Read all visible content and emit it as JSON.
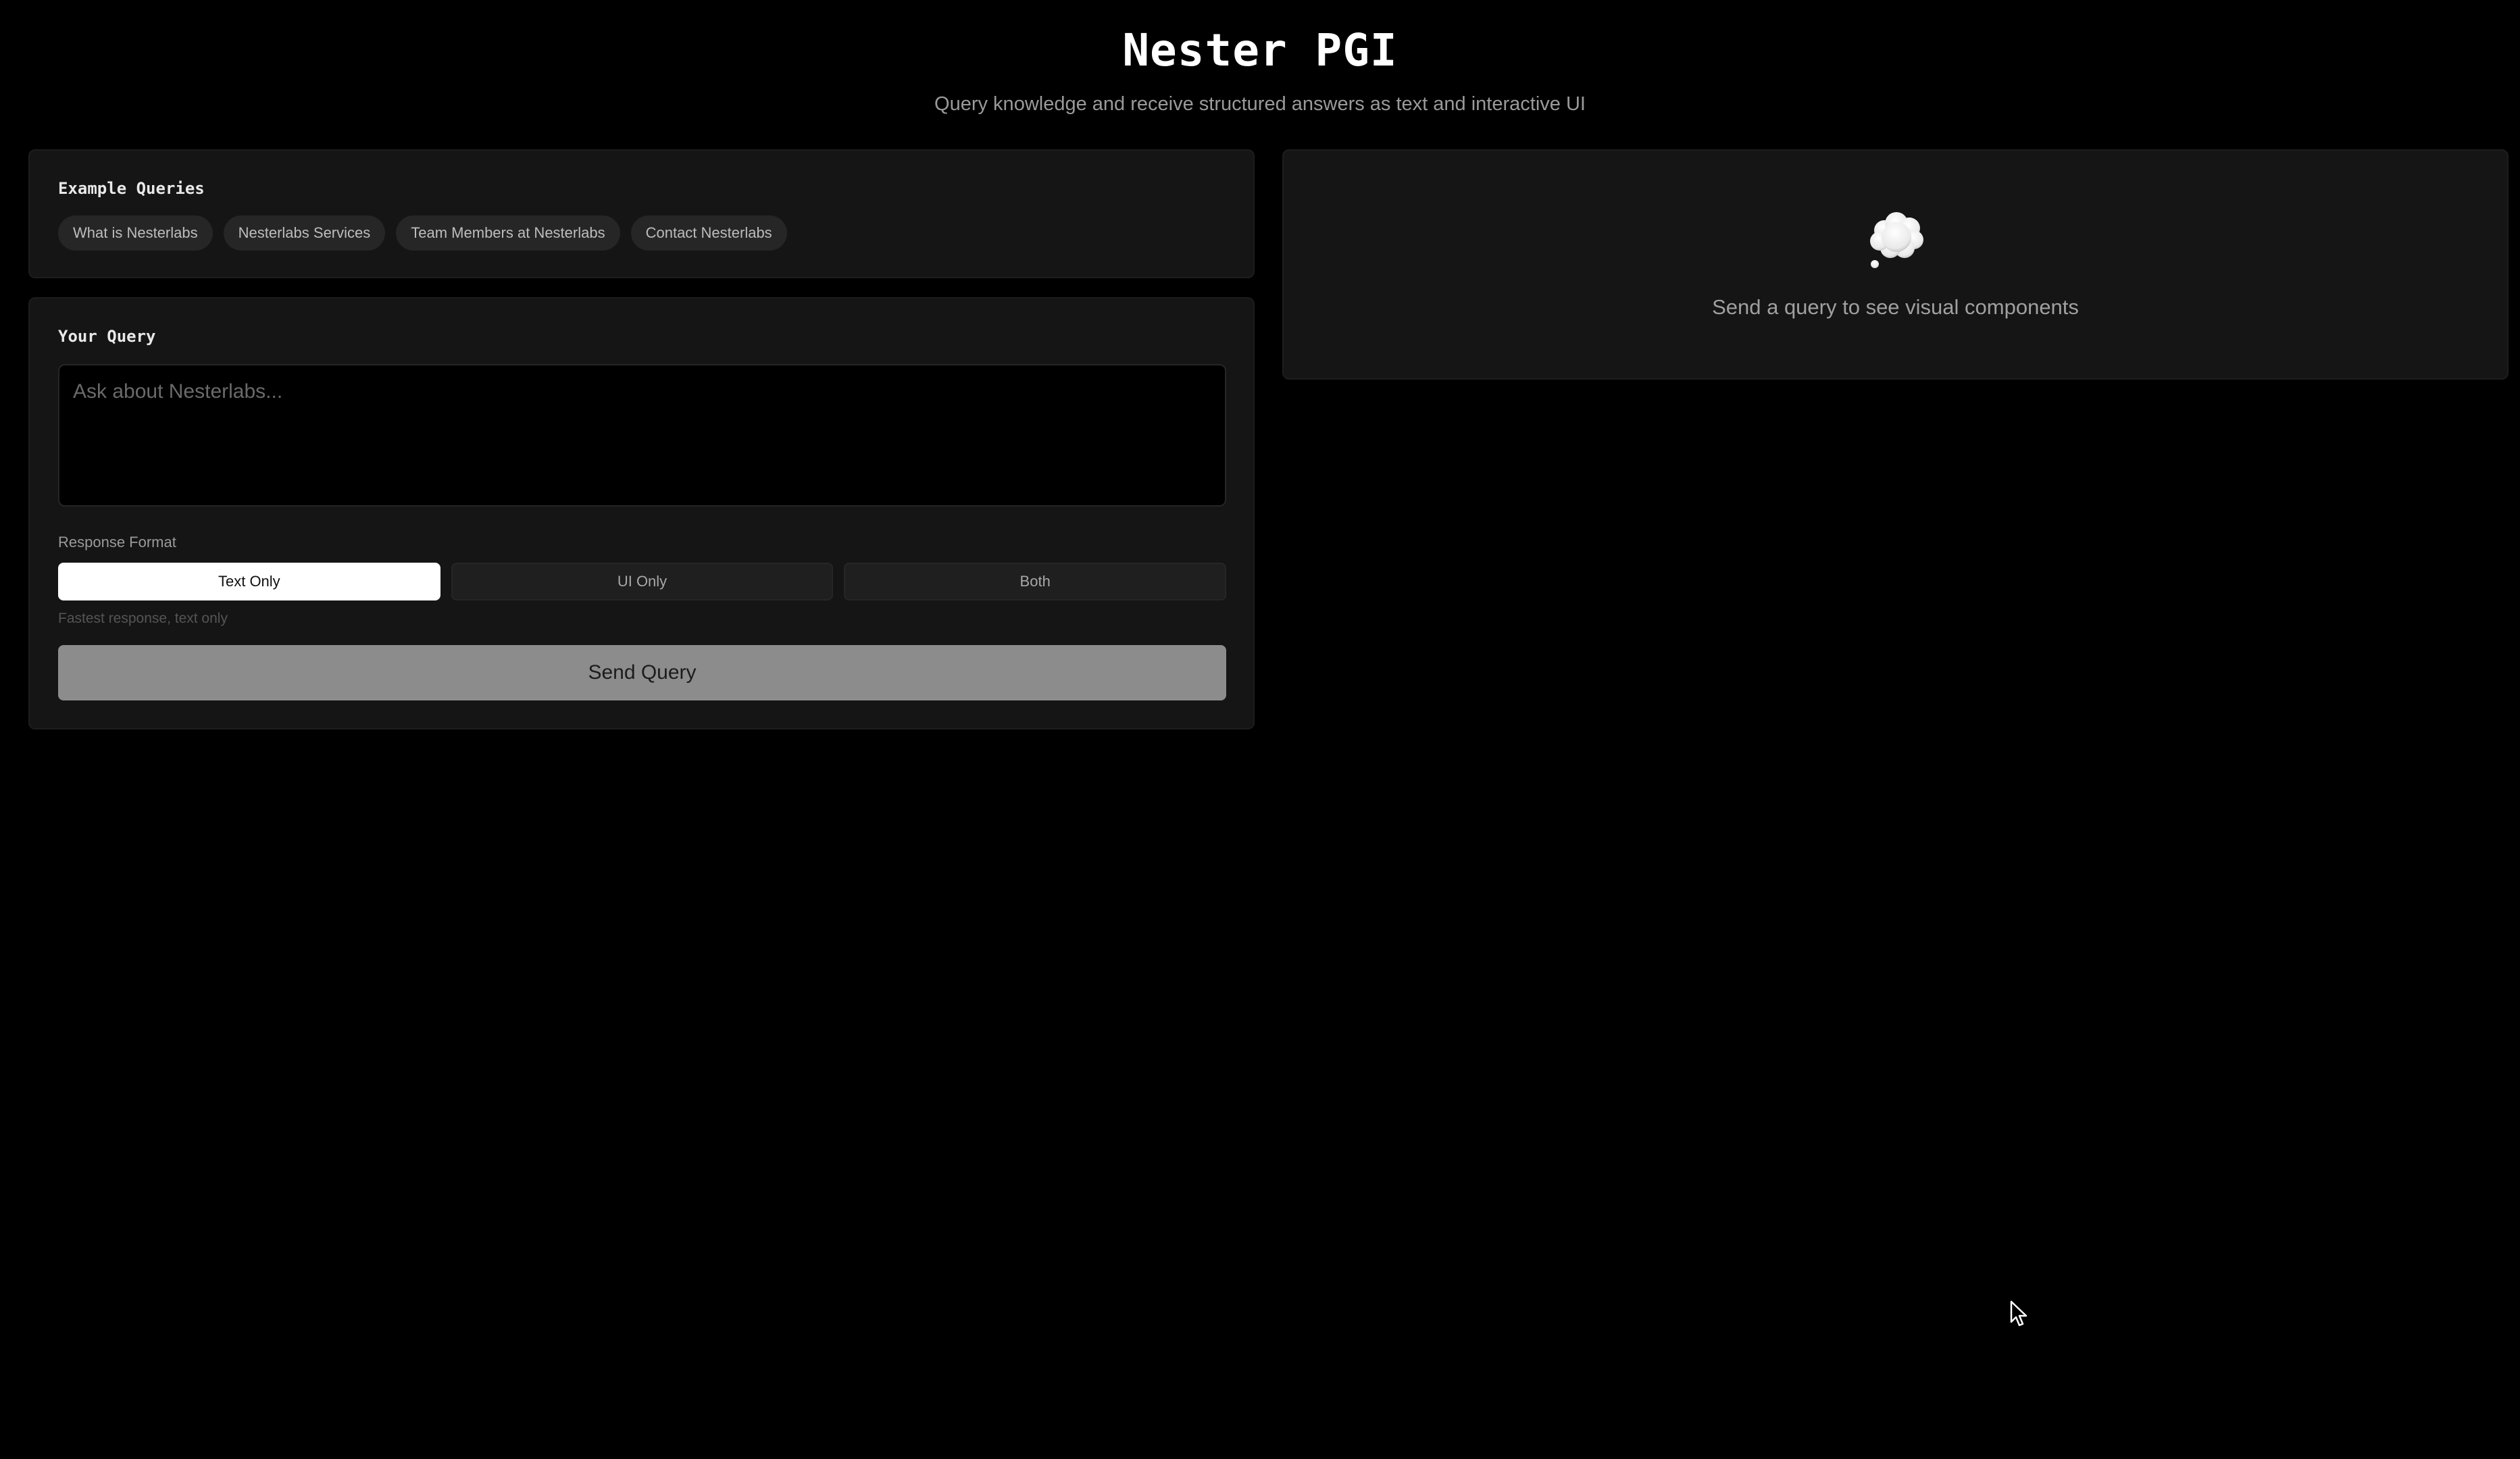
{
  "header": {
    "title": "Nester PGI",
    "subtitle": "Query knowledge and receive structured answers as text and interactive UI"
  },
  "examples": {
    "heading": "Example Queries",
    "chips": [
      "What is Nesterlabs",
      "Nesterlabs Services",
      "Team Members at Nesterlabs",
      "Contact Nesterlabs"
    ]
  },
  "query": {
    "heading": "Your Query",
    "placeholder": "Ask about Nesterlabs...",
    "value": "",
    "format_label": "Response Format",
    "formats": [
      "Text Only",
      "UI Only",
      "Both"
    ],
    "selected_format": "Text Only",
    "format_hint": "Fastest response, text only",
    "send_label": "Send Query"
  },
  "visual": {
    "icon": "thought-bubble-icon",
    "placeholder": "Send a query to see visual components"
  },
  "colors": {
    "background": "#000000",
    "card": "#151515",
    "chip": "#262626",
    "active_format": "#ffffff",
    "send_button": "#8c8c8c"
  }
}
